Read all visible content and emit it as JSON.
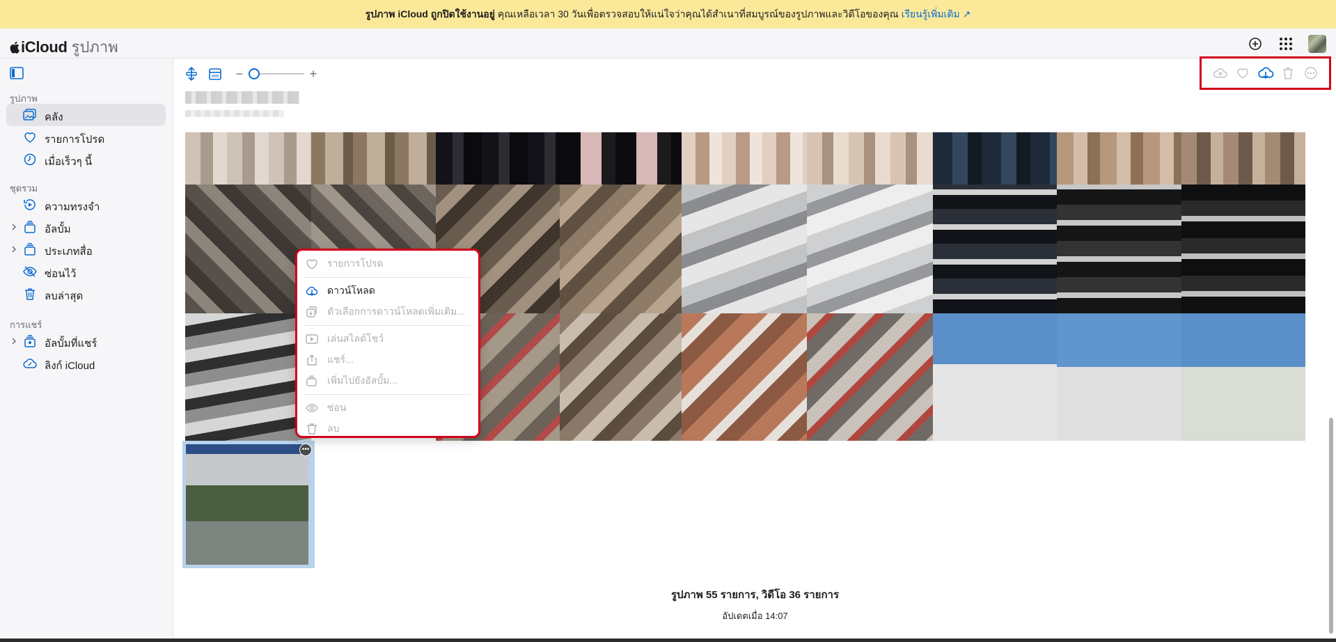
{
  "banner": {
    "bold_text": "รูปภาพ iCloud ถูกปิดใช้งานอยู่",
    "text": "คุณเหลือเวลา 30 วันเพื่อตรวจสอบให้แน่ใจว่าคุณได้สำเนาที่สมบูรณ์ของรูปภาพและวิดีโอของคุณ",
    "link": "เรียนรู้เพิ่มเติม ↗"
  },
  "header": {
    "brand": "iCloud",
    "app": "รูปภาพ"
  },
  "sidebar": {
    "section_photos": "รูปภาพ",
    "library": "คลัง",
    "favorites": "รายการโปรด",
    "recent": "เมื่อเร็วๆ นี้",
    "section_collections": "ชุดรวม",
    "memories": "ความทรงจำ",
    "albums": "อัลบั้ม",
    "media_types": "ประเภทสื่อ",
    "hidden": "ซ่อนไว้",
    "recently_deleted": "ลบล่าสุด",
    "section_sharing": "การแชร์",
    "shared_albums": "อัลบั้มที่แชร์",
    "icloud_links": "ลิงก์ iCloud"
  },
  "zoom": {
    "minus": "−",
    "plus": "+"
  },
  "context_menu": {
    "favorite": "รายการโปรด",
    "download": "ดาวน์โหลด",
    "download_options": "ตัวเลือกการดาวน์โหลดเพิ่มเติม...",
    "slideshow": "เล่นสไลด์โชว์",
    "share": "แชร์...",
    "add_to_album": "เพิ่มไปยังอัลบั้ม...",
    "hide": "ซ่อน",
    "delete": "ลบ"
  },
  "footer": {
    "count": "รูปภาพ 55 รายการ, วิดีโอ 36 รายการ",
    "updated": "อัปเดตเมื่อ 14:07"
  },
  "colors": {
    "accent": "#0a6ad2",
    "banner": "#fbe999",
    "highlight": "#d0021b"
  }
}
